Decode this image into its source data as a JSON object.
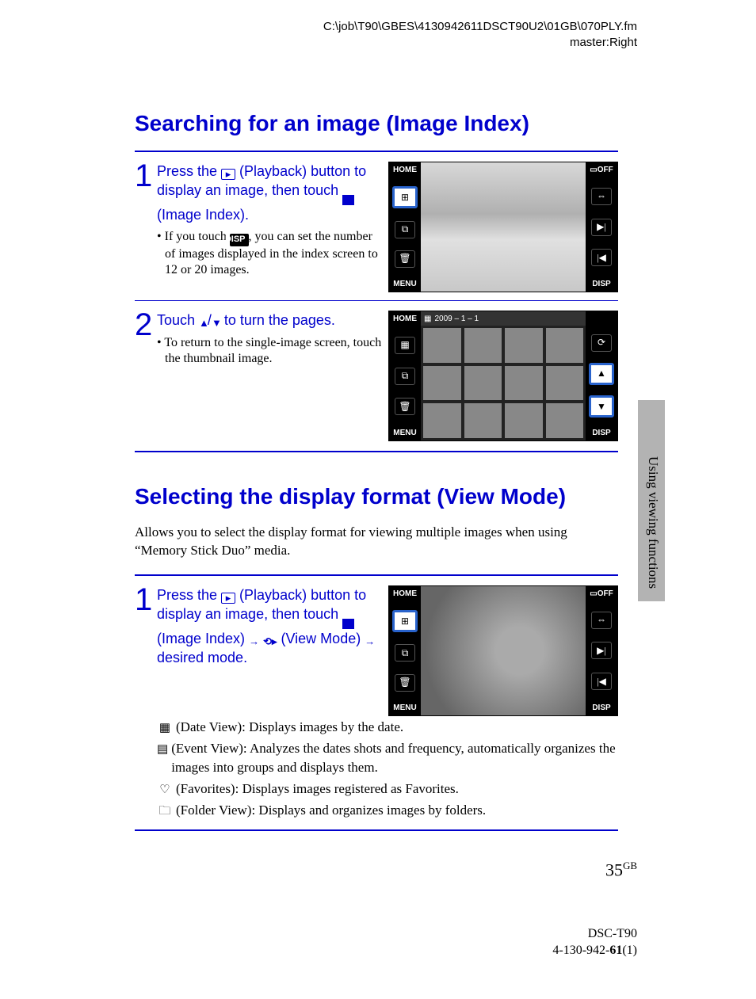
{
  "header": {
    "path": "C:\\job\\T90\\GBES\\4130942611DSCT90U2\\01GB\\070PLY.fm",
    "master": "master:Right"
  },
  "sidebar_text": "Using viewing functions",
  "page_number": "35",
  "page_super": "GB",
  "footer": {
    "model": "DSC-T90",
    "doc": "4-130-942-",
    "rev_bold": "61",
    "rev_tail": "(1)"
  },
  "section1": {
    "title": "Searching for an image (Image Index)",
    "step1": {
      "pre": "Press the ",
      "mid1": " (Playback) button to display an image, then touch ",
      "mid2": " (Image Index).",
      "bullet_pre": "If you touch ",
      "bullet_post": ", you can set the number of images displayed in the index screen to 12 or 20 images."
    },
    "step2": {
      "pre": "Touch ",
      "mid": "/",
      "post": " to turn the pages.",
      "bullet": "To return to the single-image screen, touch the thumbnail image."
    },
    "screen": {
      "home": "HOME",
      "menu": "MENU",
      "disp": "DISP",
      "off": "OFF",
      "date": "2009 – 1 – 1"
    }
  },
  "section2": {
    "title": "Selecting the display format (View Mode)",
    "intro": "Allows you to select the display format for viewing multiple images when using “Memory Stick Duo” media.",
    "step1": {
      "pre": "Press the ",
      "mid1": " (Playback) button to display an image, then touch ",
      "mid2": " (Image Index) ",
      "arrow1": "→",
      "view_label": " (View Mode) ",
      "arrow2": "→",
      "tail": " desired mode."
    },
    "modes": {
      "date": " (Date View): Displays images by the date.",
      "event": " (Event View): Analyzes the dates shots and frequency, automatically organizes the images into groups and displays them.",
      "fav": " (Favorites): Displays images registered as Favorites.",
      "folder": " (Folder View): Displays and organizes images by folders."
    }
  },
  "icons": {
    "disp_label": "DISP"
  }
}
